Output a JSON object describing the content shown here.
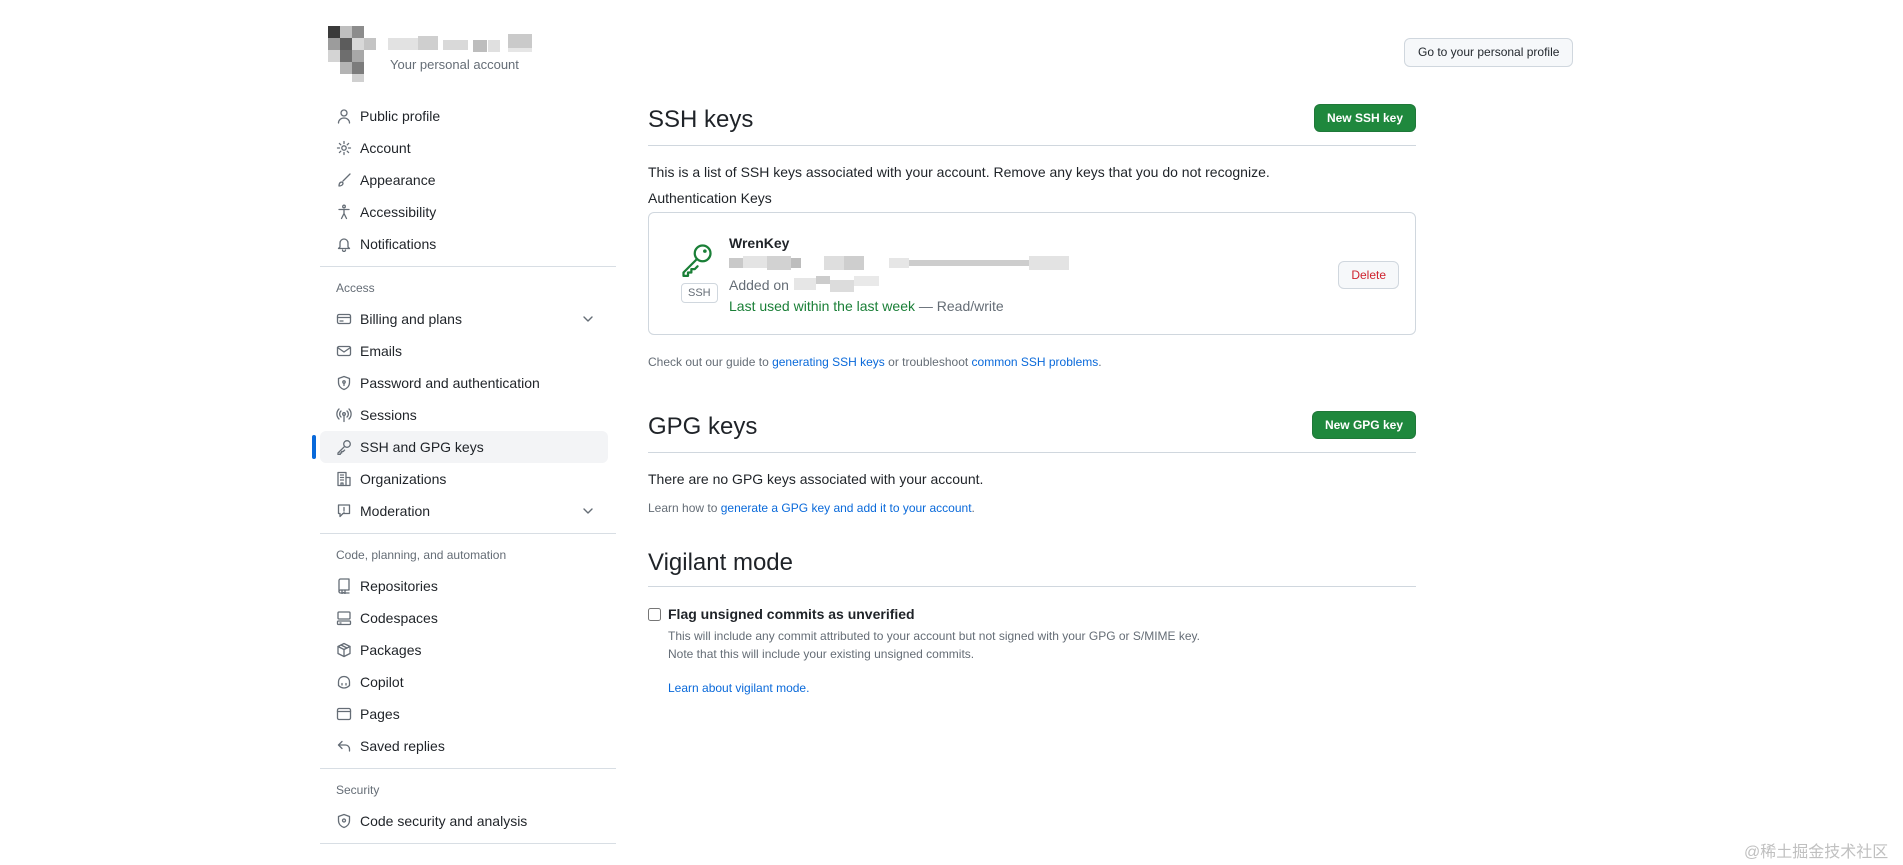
{
  "account": {
    "subtitle": "Your personal account",
    "profile_button": "Go to your personal profile"
  },
  "sidebar": {
    "items": [
      {
        "label": "Public profile",
        "icon": "person-icon"
      },
      {
        "label": "Account",
        "icon": "gear-icon"
      },
      {
        "label": "Appearance",
        "icon": "paintbrush-icon"
      },
      {
        "label": "Accessibility",
        "icon": "accessibility-icon"
      },
      {
        "label": "Notifications",
        "icon": "bell-icon"
      }
    ],
    "access_heading": "Access",
    "access_items": [
      {
        "label": "Billing and plans",
        "icon": "credit-card-icon",
        "expandable": true
      },
      {
        "label": "Emails",
        "icon": "mail-icon"
      },
      {
        "label": "Password and authentication",
        "icon": "shield-lock-icon"
      },
      {
        "label": "Sessions",
        "icon": "broadcast-icon"
      },
      {
        "label": "SSH and GPG keys",
        "icon": "key-icon",
        "active": true
      },
      {
        "label": "Organizations",
        "icon": "organization-icon"
      },
      {
        "label": "Moderation",
        "icon": "report-icon",
        "expandable": true
      }
    ],
    "code_heading": "Code, planning, and automation",
    "code_items": [
      {
        "label": "Repositories",
        "icon": "repo-icon"
      },
      {
        "label": "Codespaces",
        "icon": "codespaces-icon"
      },
      {
        "label": "Packages",
        "icon": "package-icon"
      },
      {
        "label": "Copilot",
        "icon": "copilot-icon"
      },
      {
        "label": "Pages",
        "icon": "browser-icon"
      },
      {
        "label": "Saved replies",
        "icon": "reply-icon"
      }
    ],
    "security_heading": "Security",
    "security_items": [
      {
        "label": "Code security and analysis",
        "icon": "shield-icon"
      }
    ]
  },
  "ssh": {
    "title": "SSH keys",
    "new_button": "New SSH key",
    "description": "This is a list of SSH keys associated with your account. Remove any keys that you do not recognize.",
    "auth_heading": "Authentication Keys",
    "key": {
      "name": "WrenKey",
      "badge": "SSH",
      "added_prefix": "Added on",
      "last_used": "Last used within the last week",
      "access": " — Read/write",
      "delete_button": "Delete"
    },
    "guide_prefix": "Check out our guide to ",
    "guide_link": "generating SSH keys",
    "guide_mid": " or troubleshoot ",
    "guide_link2": "common SSH problems",
    "guide_suffix": "."
  },
  "gpg": {
    "title": "GPG keys",
    "new_button": "New GPG key",
    "empty_text": "There are no GPG keys associated with your account.",
    "learn_prefix": "Learn how to ",
    "learn_link": "generate a GPG key and add it to your account",
    "learn_suffix": "."
  },
  "vigilant": {
    "title": "Vigilant mode",
    "checkbox_label": "Flag unsigned commits as unverified",
    "checked": false,
    "desc_line1": "This will include any commit attributed to your account but not signed with your GPG or S/MIME key.",
    "desc_line2": "Note that this will include your existing unsigned commits.",
    "learn_link": "Learn about vigilant mode."
  },
  "watermark": "@稀土掘金技术社区",
  "colors": {
    "accent": "#0969da",
    "primary_button": "#1f883d",
    "success_text": "#1a7f37",
    "danger_text": "#cf222e"
  }
}
